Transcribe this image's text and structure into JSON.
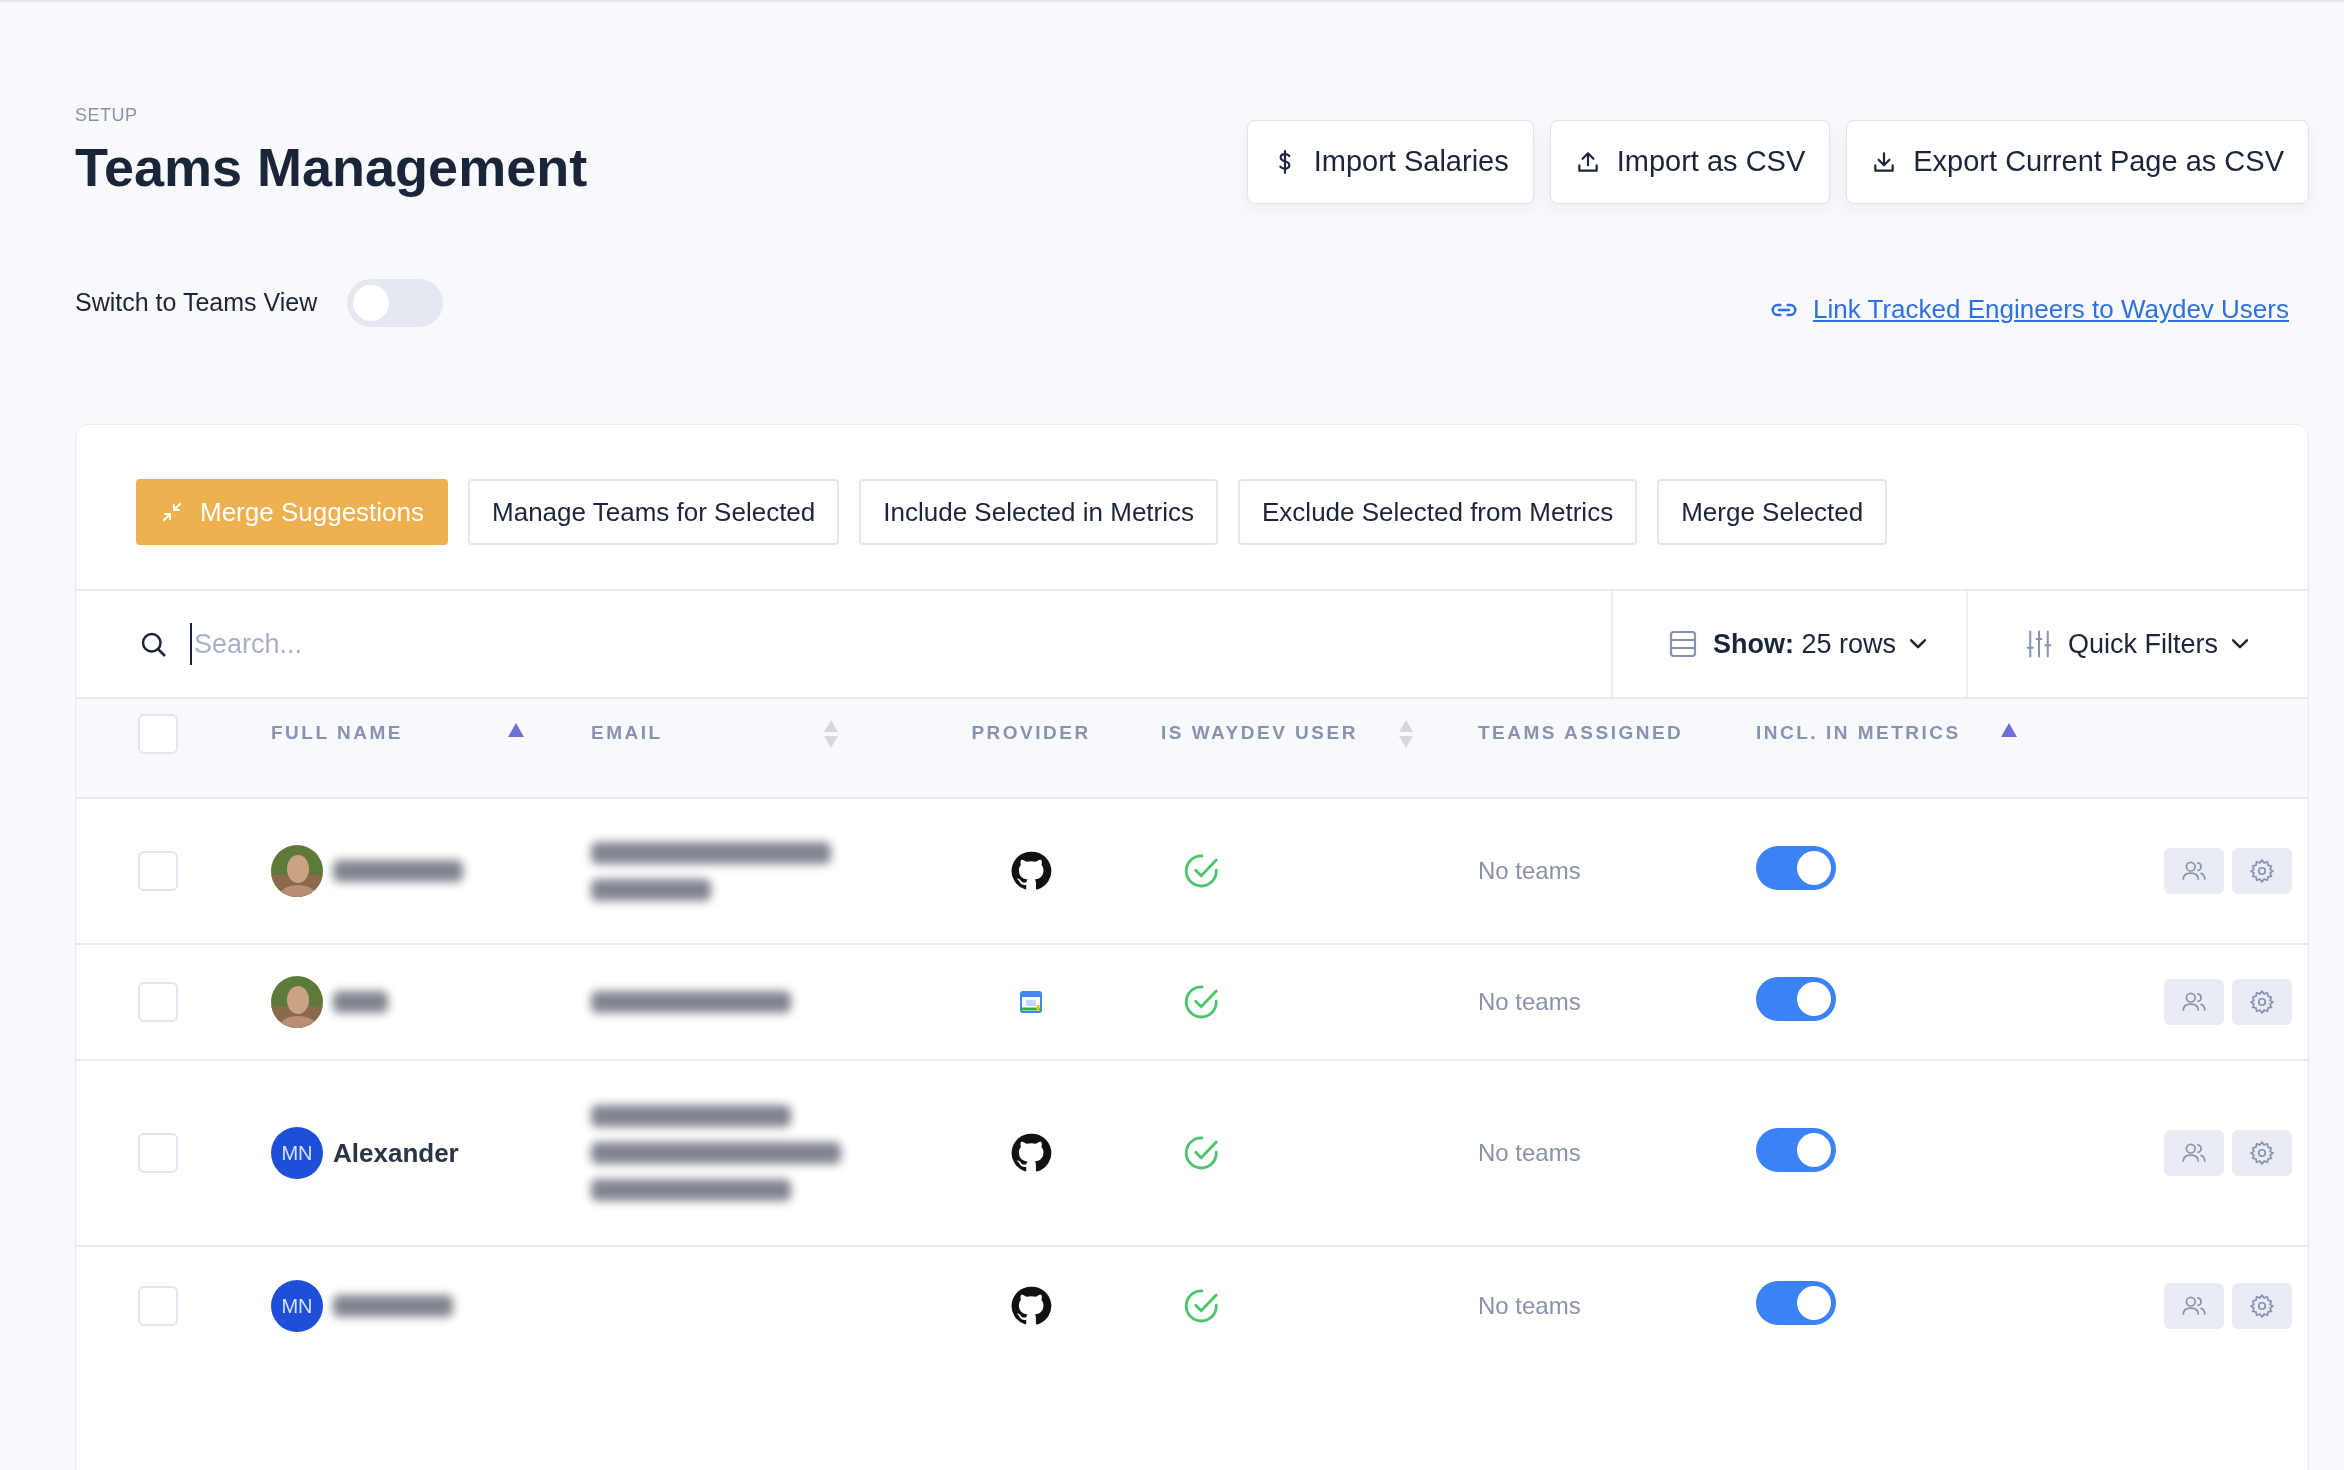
{
  "header": {
    "eyebrow": "SETUP",
    "title": "Teams Management"
  },
  "actions": [
    "Import Salaries",
    "Import as CSV",
    "Export Current Page as CSV"
  ],
  "teams_view": {
    "label": "Switch to Teams View",
    "on": false
  },
  "link": "Link Tracked Engineers to Waydev Users",
  "toolbar": [
    {
      "label": "Merge Suggestions",
      "kind": "primary"
    },
    {
      "label": "Manage Teams for Selected",
      "kind": "outline"
    },
    {
      "label": "Include Selected in Metrics",
      "kind": "outline"
    },
    {
      "label": "Exclude Selected from Metrics",
      "kind": "outline"
    },
    {
      "label": "Merge Selected",
      "kind": "outline"
    }
  ],
  "search": {
    "placeholder": "Search..."
  },
  "show": {
    "label": "Show:",
    "value": "25 rows"
  },
  "quick_filters": "Quick Filters",
  "table": {
    "select_all": {
      "checked": false
    },
    "columns": [
      {
        "label": "FULL NAME",
        "sorted": true
      },
      {
        "label": "EMAIL",
        "sorted": false
      },
      {
        "label": "PROVIDER"
      },
      {
        "label": "IS WAYDEV USER",
        "sorted": false
      },
      {
        "label": "TEAMS ASSIGNED"
      },
      {
        "label": "INCL. IN METRICS",
        "sorted": true
      }
    ],
    "rows": [
      {
        "checked": false,
        "provider": {
          "kind": "github"
        },
        "waydev_user": true,
        "teams": "No teams",
        "included": true
      },
      {
        "checked": false,
        "provider": {
          "kind": "calendar"
        },
        "waydev_user": true,
        "teams": "No teams",
        "included": true
      },
      {
        "checked": false,
        "avatar": {
          "kind": "initials",
          "text": "MN"
        },
        "name": "Alexander",
        "provider": {
          "kind": "github"
        },
        "waydev_user": true,
        "teams": "No teams",
        "included": true
      },
      {
        "checked": false,
        "avatar": {
          "kind": "initials",
          "text": "MN"
        },
        "provider": {
          "kind": "github"
        },
        "waydev_user": true,
        "teams": "No teams",
        "included": true
      }
    ]
  }
}
